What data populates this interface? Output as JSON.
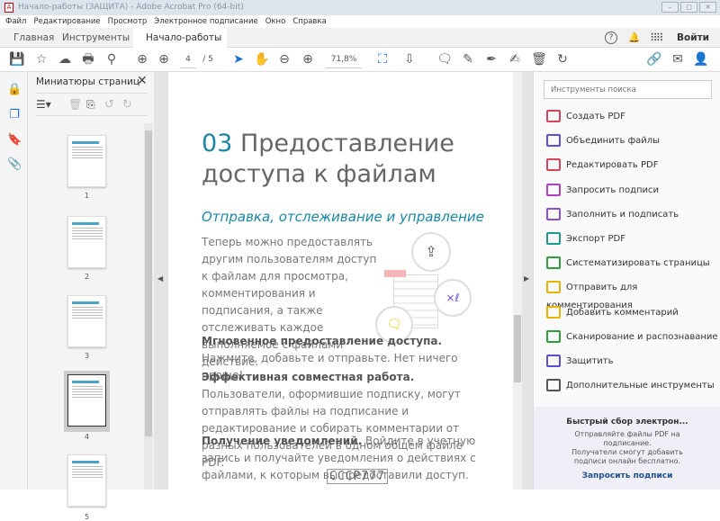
{
  "window": {
    "title": "Начало-работы (ЗАЩИТА) - Adobe Acrobat Pro (64-bit)",
    "minimize": "–",
    "maximize": "▢",
    "close": "✕"
  },
  "menu": [
    "Файл",
    "Редактирование",
    "Просмотр",
    "Электронное подписание",
    "Окно",
    "Справка"
  ],
  "tabs": {
    "home": "Главная",
    "tools": "Инструменты",
    "document": "Начало-работы (З...",
    "close": "×",
    "signin": "Войти"
  },
  "toolbar": {
    "page_current": "4",
    "page_total": "/ 5",
    "zoom": "71,8%"
  },
  "thumbnails": {
    "title": "Миниатюры страниц",
    "pages": [
      "1",
      "2",
      "3",
      "4",
      "5"
    ],
    "selected": "4"
  },
  "document": {
    "number": "03",
    "heading_1": "Предоставление",
    "heading_2": "доступа к файлам",
    "subtitle": "Отправка, отслеживание и управление",
    "intro": "Теперь можно предоставлять другим пользователям доступ к файлам для просмотра, комментирования и подписания, а также отслеживать каждое выполняемое с файлами действие.",
    "p1_bold": "Мгновенное предоставление доступа.",
    "p1": "Нажмите, добавьте и отправьте. Нет ничего проще!",
    "p2_bold": "Эффективная совместная работа.",
    "p2": "Пользователи, оформившие подписку, могут отправлять файлы на подписание и редактирование и собирать комментарии от разных пользователей в одном общем файле PDF.",
    "p3_bold": "Получение уведомлений.",
    "p3": "Войдите в учетную запись и получайте уведомления о действиях с файлами, к которым вы предоставили доступ.",
    "watermark": "CCCP777"
  },
  "right_panel": {
    "search_placeholder": "Инструменты поиска",
    "tools": [
      {
        "label": "Создать PDF",
        "color": "#d9435a"
      },
      {
        "label": "Объединить файлы",
        "color": "#5b4fd6"
      },
      {
        "label": "Редактировать PDF",
        "color": "#d9435a"
      },
      {
        "label": "Запросить подписи",
        "color": "#b13fc4"
      },
      {
        "label": "Заполнить и подписать",
        "color": "#8a4fd6"
      },
      {
        "label": "Экспорт PDF",
        "color": "#1f9a8a"
      },
      {
        "label": "Систематизировать страницы",
        "color": "#2f9e3a"
      },
      {
        "label": "Отправить для комментирования",
        "color": "#e8b400"
      },
      {
        "label": "Добавить комментарий",
        "color": "#e8b400"
      },
      {
        "label": "Сканирование и распознавание",
        "color": "#2f9e3a"
      },
      {
        "label": "Защитить",
        "color": "#5b4fd6"
      },
      {
        "label": "Дополнительные инструменты",
        "color": "#555555"
      }
    ],
    "promo": {
      "title": "Быстрый сбор электрон...",
      "line1": "Отправляйте файлы PDF на",
      "line2": "подписание.",
      "line3": "Получатели смогут добавить",
      "line4": "подписи онлайн бесплатно.",
      "link": "Запросить подписи"
    }
  }
}
